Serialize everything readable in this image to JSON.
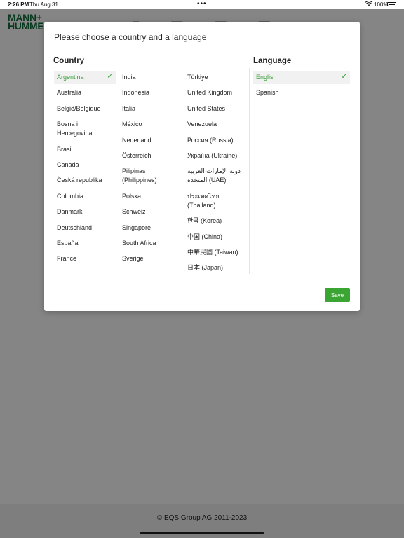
{
  "status_bar": {
    "time": "2:26 PM",
    "date": "Thu Aug 31",
    "dots": "•••",
    "battery": "100%"
  },
  "header": {
    "logo_line1": "MANN+",
    "logo_line2": "HUMME"
  },
  "modal": {
    "title": "Please choose a country and a language",
    "country_title": "Country",
    "language_title": "Language",
    "countries": [
      [
        "Argentina",
        "Australia",
        "België/Belgique",
        "Bosna i Hercegovina",
        "Brasil",
        "Canada",
        "Česká republika",
        "Colombia",
        "Danmark",
        "Deutschland",
        "España",
        "France"
      ],
      [
        "India",
        "Indonesia",
        "Italia",
        "México",
        "Nederland",
        "Österreich",
        "Pilipinas (Philippines)",
        "Polska",
        "Schweiz",
        "Singapore",
        "South Africa",
        "Sverige"
      ],
      [
        "Türkiye",
        "United Kingdom",
        "United States",
        "Venezuela",
        "Россия (Russia)",
        "Україна (Ukraine)",
        "دولة الإمارات العربية المتحدة (UAE)",
        "ประเทศไทย (Thailand)",
        "한국 (Korea)",
        "中国 (China)",
        "中華民國 (Taiwan)",
        "日本 (Japan)"
      ]
    ],
    "selected_country": "Argentina",
    "languages": [
      "English",
      "Spanish"
    ],
    "selected_language": "English",
    "check_glyph": "✓",
    "save_label": "Save"
  },
  "footer": {
    "copyright": "© EQS Group AG 2011-2023"
  },
  "colors": {
    "accent": "#3aa533",
    "brand": "#0d6e3a",
    "overlay": "rgba(0,0,0,0.48)"
  }
}
